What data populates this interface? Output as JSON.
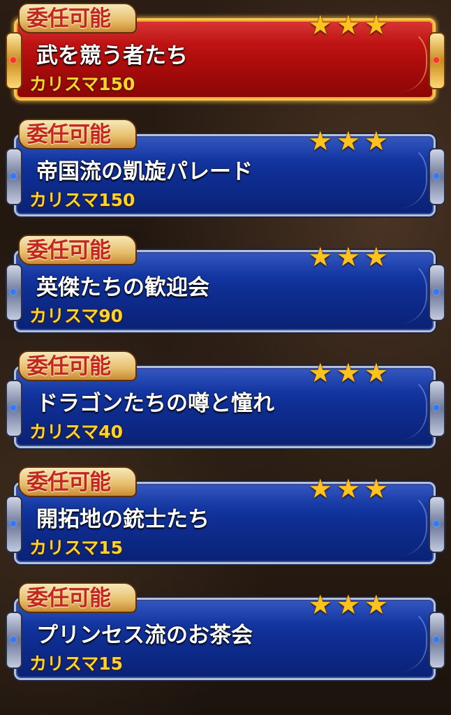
{
  "missions": [
    {
      "badge": "委任可能",
      "title": "武を競う者たち",
      "charisma": "カリスマ150",
      "stars": 3,
      "selected": true,
      "theme": "red"
    },
    {
      "badge": "委任可能",
      "title": "帝国流の凱旋パレード",
      "charisma": "カリスマ150",
      "stars": 3,
      "selected": false,
      "theme": "blue"
    },
    {
      "badge": "委任可能",
      "title": "英傑たちの歓迎会",
      "charisma": "カリスマ90",
      "stars": 3,
      "selected": false,
      "theme": "blue"
    },
    {
      "badge": "委任可能",
      "title": "ドラゴンたちの噂と憧れ",
      "charisma": "カリスマ40",
      "stars": 3,
      "selected": false,
      "theme": "blue"
    },
    {
      "badge": "委任可能",
      "title": "開拓地の銃士たち",
      "charisma": "カリスマ15",
      "stars": 3,
      "selected": false,
      "theme": "blue"
    },
    {
      "badge": "委任可能",
      "title": "プリンセス流のお茶会",
      "charisma": "カリスマ15",
      "stars": 3,
      "selected": false,
      "theme": "blue"
    }
  ],
  "colors": {
    "selected_panel": "#b00d0d",
    "panel": "#0f2f95",
    "badge_text": "#c2281c",
    "star": "#ffc21f",
    "charisma_text": "#ffd22e"
  },
  "icons": {
    "star": "★"
  }
}
